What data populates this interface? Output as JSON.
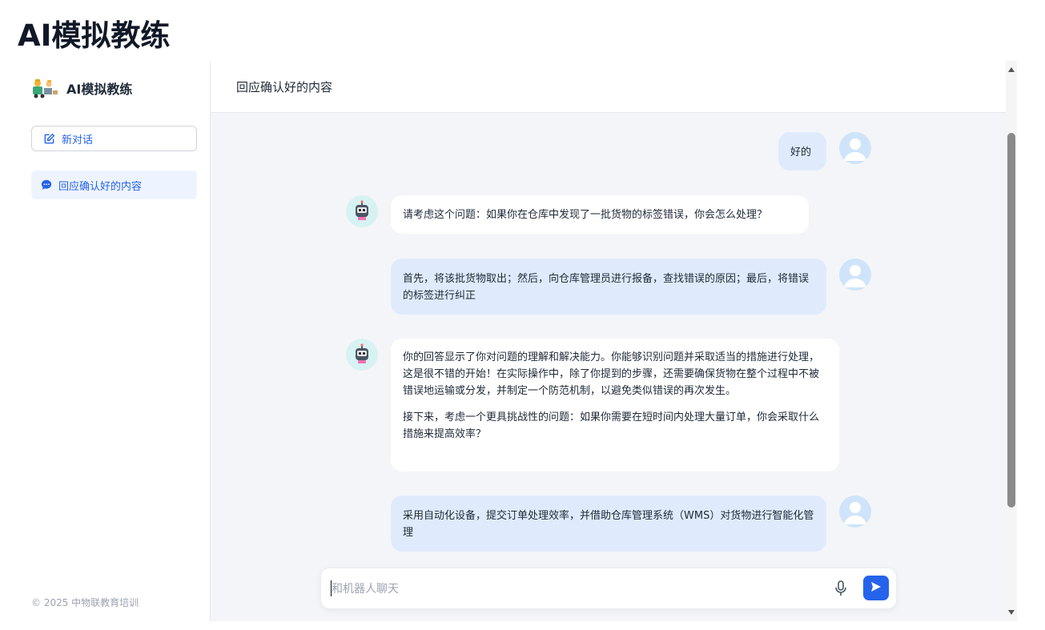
{
  "app": {
    "title": "AI模拟教练"
  },
  "sidebar": {
    "brand_name": "AI模拟教练",
    "new_chat_label": "新对话",
    "conversations": [
      {
        "label": "回应确认好的内容"
      }
    ],
    "footer": "© 2025 中物联教育培训"
  },
  "chat": {
    "header_title": "回应确认好的内容",
    "messages": [
      {
        "role": "user",
        "text": "好的"
      },
      {
        "role": "bot",
        "text": "请考虑这个问题：如果你在仓库中发现了一批货物的标签错误，你会怎么处理？"
      },
      {
        "role": "user",
        "text": "首先，将该批货物取出；然后，向仓库管理员进行报备，查找错误的原因；最后，将错误的标签进行纠正"
      },
      {
        "role": "bot",
        "paragraphs": [
          "你的回答显示了你对问题的理解和解决能力。你能够识别问题并采取适当的措施进行处理，这是很不错的开始！在实际操作中，除了你提到的步骤，还需要确保货物在整个过程中不被错误地运输或分发，并制定一个防范机制，以避免类似错误的再次发生。",
          "接下来，考虑一个更具挑战性的问题：如果你需要在短时间内处理大量订单，你会采取什么措施来提高效率？"
        ]
      },
      {
        "role": "user",
        "text": "采用自动化设备，提交订单处理效率，并借助仓库管理系统（WMS）对货物进行智能化管理"
      }
    ]
  },
  "input": {
    "placeholder": "和机器人聊天",
    "value": ""
  },
  "icons": {
    "new_chat": "edit-icon",
    "conversation": "chat-bubble-icon",
    "mic": "microphone-icon",
    "send": "send-icon",
    "user_avatar": "user-avatar-icon",
    "bot_avatar": "robot-avatar-icon"
  },
  "colors": {
    "accent": "#2563eb",
    "user_bubble": "#dfebfc",
    "bot_bubble": "#ffffff",
    "background": "#f4f5f8"
  }
}
